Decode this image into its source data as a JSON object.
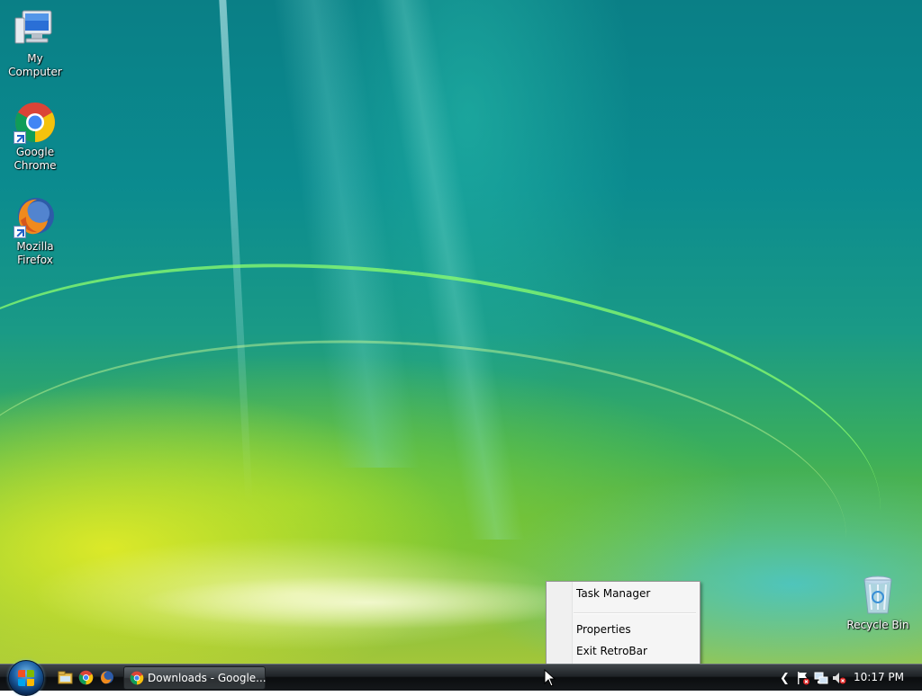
{
  "desktop": {
    "icons": [
      {
        "label_line1": "My Computer",
        "label_line2": ""
      },
      {
        "label_line1": "Google",
        "label_line2": "Chrome"
      },
      {
        "label_line1": "Mozilla",
        "label_line2": "Firefox"
      },
      {
        "label_line1": "Recycle Bin",
        "label_line2": ""
      }
    ]
  },
  "context_menu": {
    "items": [
      {
        "label": "Task Manager"
      },
      {
        "label": "Properties"
      },
      {
        "label": "Exit RetroBar"
      }
    ]
  },
  "taskbar": {
    "start_icon": "windows-start-orb",
    "quick_launch": [
      "explorer-icon",
      "chrome-icon",
      "firefox-icon"
    ],
    "tasks": [
      {
        "label": "Downloads - Google...",
        "icon": "chrome-icon"
      }
    ],
    "tray": {
      "icons": [
        "show-hidden-icons-chevron",
        "action-center-flag-icon",
        "network-icon",
        "volume-muted-icon"
      ],
      "clock": "10:17 PM"
    }
  },
  "colors": {
    "taskbar": "#1e2226",
    "menu_bg": "#f5f5f5",
    "wallpaper_teal": "#0b8b8f",
    "wallpaper_yellow": "#a2c63a"
  }
}
